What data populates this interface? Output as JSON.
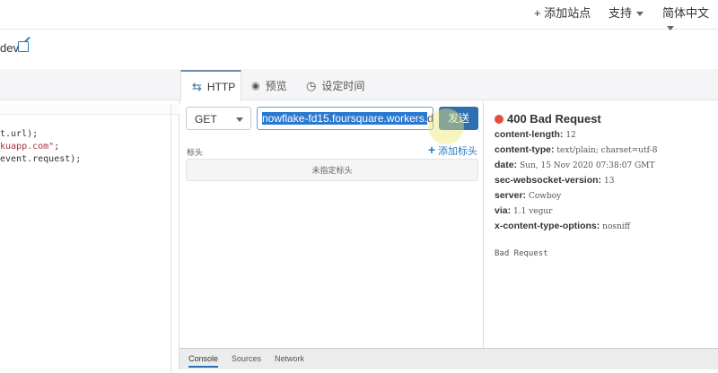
{
  "topbar": {
    "add_site": "+ 添加站点",
    "support": "支持",
    "language": "简体中文"
  },
  "header": {
    "name_fragment": "dev"
  },
  "tabs": [
    {
      "label": "HTTP",
      "icon": "arrows-swap-icon"
    },
    {
      "label": "预览",
      "icon": "eye-icon"
    },
    {
      "label": "设定时间",
      "icon": "clock-icon"
    }
  ],
  "code": {
    "line1": "t.url);",
    "line2_str": "kuapp.com\"",
    "line2_end": ";",
    "line3": "event.request);"
  },
  "request": {
    "method": "GET",
    "url_selected": "nowflake-fd15.foursquare.workers.",
    "url_rest": "de",
    "send_label": "发送",
    "headers_label": "标头",
    "add_header_label": "添加标头",
    "no_headers": "未指定标头"
  },
  "response": {
    "status": "400 Bad Request",
    "status_color": "#e74c3c",
    "headers": [
      {
        "key": "content-length:",
        "value": "12"
      },
      {
        "key": "content-type:",
        "value": "text/plain; charset=utf-8"
      },
      {
        "key": "date:",
        "value": "Sun, 15 Nov 2020 07:38:07 GMT"
      },
      {
        "key": "sec-websocket-version:",
        "value": "13"
      },
      {
        "key": "server:",
        "value": "Cowboy"
      },
      {
        "key": "via:",
        "value": "1.1 vegur"
      },
      {
        "key": "x-content-type-options:",
        "value": "nosniff"
      }
    ],
    "body": "Bad Request"
  },
  "devtools": {
    "tabs": [
      "Console",
      "Sources",
      "Network"
    ]
  }
}
